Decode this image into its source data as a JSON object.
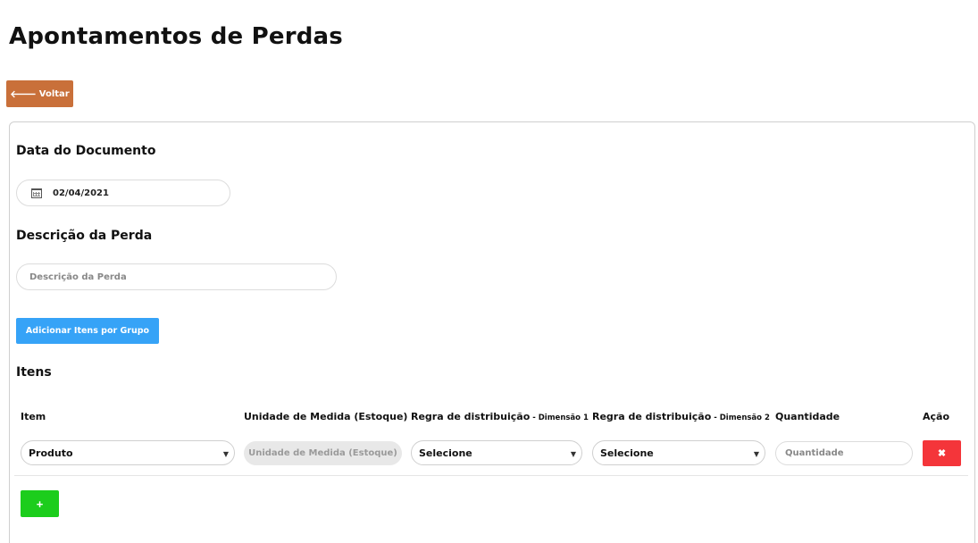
{
  "page": {
    "title": "Apontamentos de Perdas",
    "back_label": "Voltar"
  },
  "form": {
    "date_label": "Data do Documento",
    "date_value": "02/04/2021",
    "description_label": "Descrição da Perda",
    "description_placeholder": "Descrição da Perda",
    "description_value": "",
    "group_button_label": "Adicionar Itens por Grupo",
    "items_label": "Itens"
  },
  "table": {
    "headers": {
      "item": "Item",
      "unit": "Unidade de Medida (Estoque)",
      "rule1": "Regra de distribuição",
      "rule1_sub": " - Dimensão 1",
      "rule2": "Regra de distribuição",
      "rule2_sub": " - Dimensão 2",
      "quantity": "Quantidade",
      "action": "Ação"
    },
    "rows": [
      {
        "item": "Produto",
        "unit_placeholder": "Unidade de Medida (Estoque)",
        "rule1": "Selecione",
        "rule2": "Selecione",
        "quantity_placeholder": "Quantidade",
        "quantity_value": "",
        "delete_label": "✖"
      }
    ],
    "add_label": "+"
  },
  "icons": {
    "back": "arrow-left-icon",
    "date": "calendar-icon",
    "caret": "chevron-down-icon",
    "delete": "close-icon",
    "add": "plus-icon"
  },
  "colors": {
    "back_button": "#c9703a",
    "group_button": "#36a3f7",
    "delete_button": "#f4353a",
    "add_button": "#1ccd1c"
  }
}
